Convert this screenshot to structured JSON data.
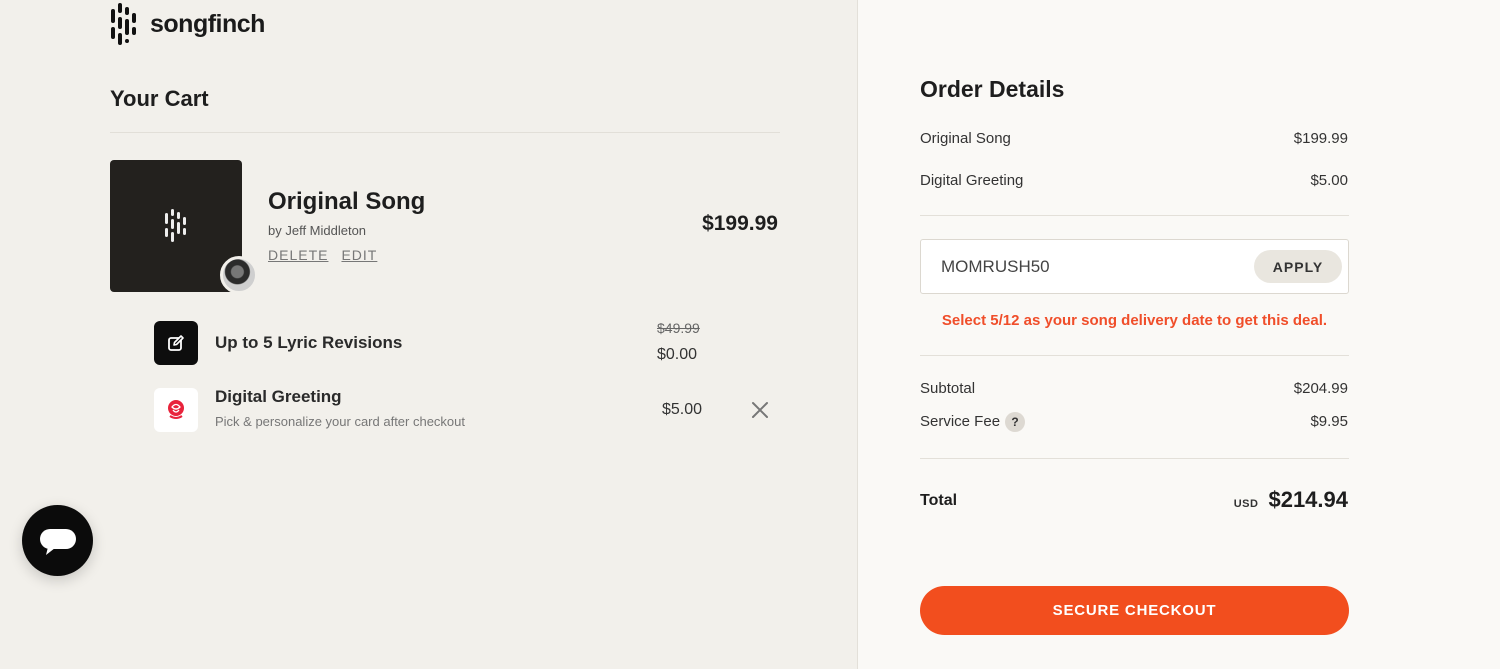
{
  "brand": {
    "name": "songfinch"
  },
  "cart": {
    "title": "Your Cart",
    "item": {
      "title": "Original Song",
      "artist": "by Jeff Middleton",
      "delete_label": "DELETE",
      "edit_label": "EDIT",
      "price": "$199.99"
    },
    "addons": [
      {
        "name": "Up to 5 Lyric Revisions",
        "original_price": "$49.99",
        "price": "$0.00",
        "icon": "edit-icon"
      },
      {
        "name": "Digital Greeting",
        "subtitle": "Pick & personalize your card after checkout",
        "price": "$5.00",
        "icon": "rose-icon"
      }
    ]
  },
  "order": {
    "title": "Order Details",
    "lines": [
      {
        "label": "Original Song",
        "value": "$199.99"
      },
      {
        "label": "Digital Greeting",
        "value": "$5.00"
      }
    ],
    "promo": {
      "code": "MOMRUSH50",
      "apply_label": "APPLY",
      "message": "Select 5/12 as your song delivery date to get this deal."
    },
    "subtotal": {
      "label": "Subtotal",
      "value": "$204.99"
    },
    "service_fee": {
      "label": "Service Fee",
      "help": "?",
      "value": "$9.95"
    },
    "total": {
      "label": "Total",
      "currency": "USD",
      "value": "$214.94"
    },
    "checkout_label": "SECURE CHECKOUT"
  },
  "colors": {
    "accent": "#f24e1e",
    "promo_message": "#f04e2a",
    "left_bg": "#f2f0eb",
    "right_bg": "#faf9f6"
  }
}
